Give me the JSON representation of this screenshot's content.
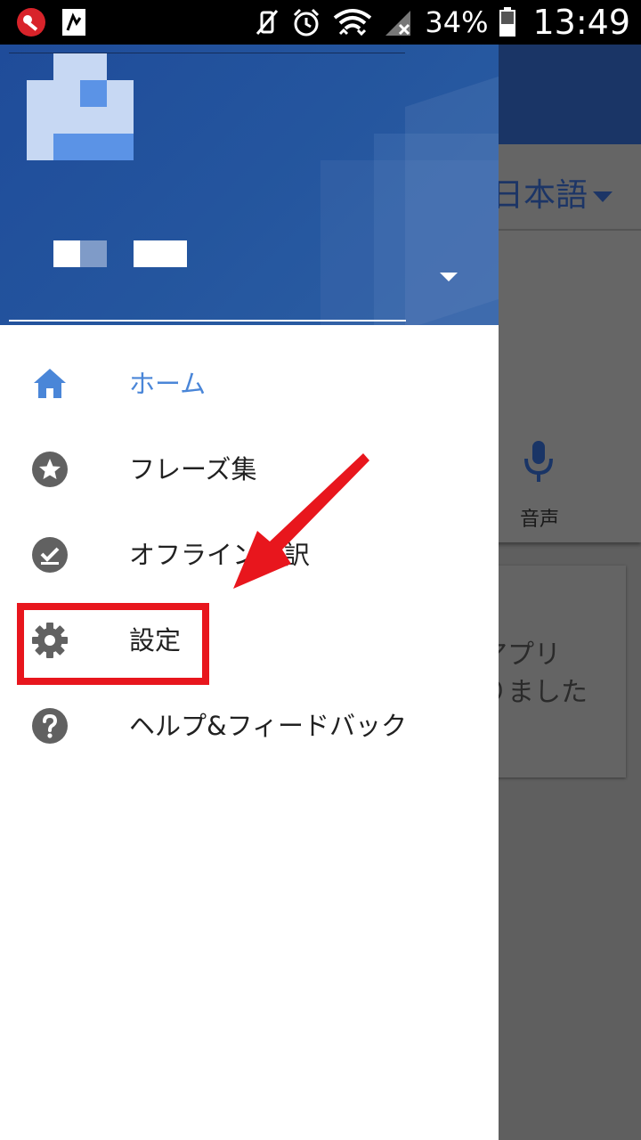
{
  "status_bar": {
    "battery_percent": "34%",
    "clock": "13:49",
    "icons": [
      "key-notification-icon",
      "app-notification-icon",
      "vibrate-off-icon",
      "alarm-icon",
      "wifi-icon",
      "no-signal-icon",
      "battery-icon"
    ]
  },
  "drawer": {
    "menu": [
      {
        "label": "ホーム",
        "icon": "home-icon",
        "active": true
      },
      {
        "label": "フレーズ集",
        "icon": "star-icon",
        "active": false
      },
      {
        "label": "オフライン翻訳",
        "icon": "offline-download-icon",
        "active": false
      },
      {
        "label": "設定",
        "icon": "gear-icon",
        "active": false
      },
      {
        "label": "ヘルプ&フィードバック",
        "icon": "help-icon",
        "active": false
      }
    ]
  },
  "background_app": {
    "target_language": "日本語",
    "voice_label": "音声",
    "card_text": "アプリ\nりました"
  },
  "colors": {
    "header_blue": "#24559e",
    "active_blue": "#4a86d8",
    "highlight_red": "#e8161d",
    "scrim": "#5f5f5f"
  }
}
